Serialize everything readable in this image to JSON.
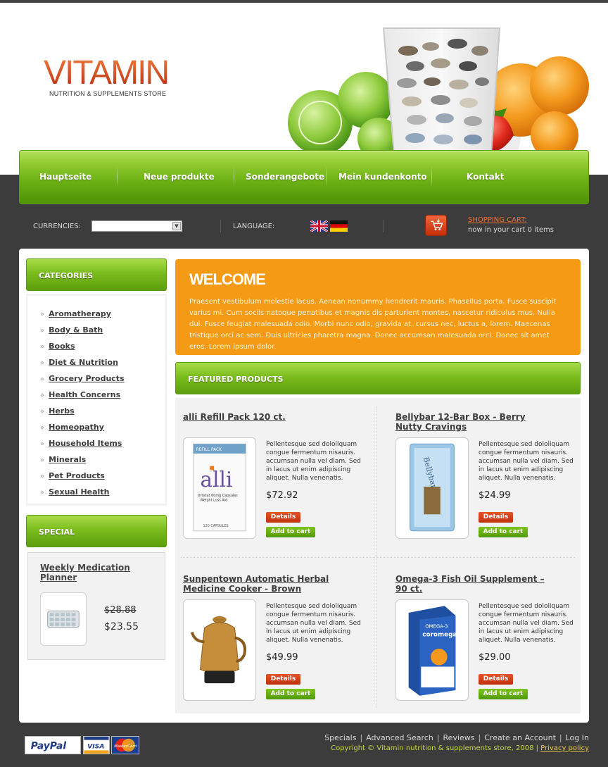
{
  "brand": {
    "title": "VITAMIN",
    "subtitle": "NUTRITION & SUPPLEMENTS STORE"
  },
  "nav": {
    "items": [
      "Hauptseite",
      "Neue produkte",
      "Sonderangebote",
      "Mein kundenkonto",
      "Kontakt"
    ]
  },
  "toolbar": {
    "currencies_label": "CURRENCIES:",
    "currency_value": "",
    "language_label": "LANGUAGE:",
    "languages": [
      "english-flag",
      "german-flag"
    ],
    "cart_link": "SHOPPING CART:",
    "cart_status": "now in your cart 0 items"
  },
  "sidebar": {
    "categories_title": "CATEGORIES",
    "categories": [
      "Aromatherapy",
      "Body & Bath",
      "Books",
      "Diet & Nutrition",
      "Grocery Products",
      "Health Concerns",
      "Herbs",
      "Homeopathy",
      "Household Items",
      "Minerals",
      "Pet Products",
      "Sexual Health"
    ],
    "special_title": "SPECIAL",
    "special": {
      "name": "Weekly Medication Planner",
      "old_price": "$28.88",
      "new_price": "$23.55"
    }
  },
  "welcome": {
    "title": "WELCOME",
    "text": "Praesent vestibulum molestie lacus. Aenean nonummy hendrerit mauris. Phasellus porta. Fusce suscipit varius mi. Cum sociis natoque penatibus et magnis dis parturient montes, nascetur ridiculus mus. Nulla dui. Fusce feugiat malesuada odio. Morbi nunc odio, gravida at, cursus nec, luctus a, lorem. Maecenas tristique orci ac sem. Duis ultricies pharetra magna. Donec accumsan malesuada orci. Donec sit amet eros. Lorem ipsum dolor."
  },
  "featured": {
    "title": "FEATURED PRODUCTS",
    "details_label": "Details",
    "cart_label": "Add to cart",
    "products": [
      {
        "name": "alli Refill Pack 120 ct.",
        "desc": "Pellentesque sed dololiquam congue fermentum nisauris. accumsan nulla vel diam. Sed in lacus ut enim adipiscing aliquet. Nulla venenatis.",
        "price": "$72.92"
      },
      {
        "name": "Bellybar 12-Bar Box - Berry Nutty Cravings",
        "desc": "Pellentesque sed dololiquam congue fermentum nisauris. accumsan nulla vel diam. Sed in lacus ut enim adipiscing aliquet. Nulla venenatis.",
        "price": "$24.99"
      },
      {
        "name": "Sunpentown Automatic Herbal Medicine Cooker - Brown",
        "desc": "Pellentesque sed dololiquam congue fermentum nisauris. accumsan nulla vel diam. Sed in lacus ut enim adipiscing aliquet. Nulla venenatis.",
        "price": "$49.99"
      },
      {
        "name": "Omega-3 Fish Oil Supplement – 90 ct.",
        "desc": "Pellentesque sed dololiquam congue fermentum nisauris. accumsan nulla vel diam. Sed in lacus ut enim adipiscing aliquet. Nulla venenatis.",
        "price": "$29.00"
      }
    ],
    "product_labels": {
      "alli_box_top": "REFILL PACK",
      "alli_logo": "alli",
      "alli_line1": "Orlistat 60mg Capsules",
      "alli_line2": "Weight Loss Aid",
      "alli_count": "120 CAPSULES",
      "bellybar_logo": "Bellybar",
      "omega_top": "OMEGA-3",
      "omega_brand": "coromega"
    }
  },
  "footer": {
    "links": [
      "Specials",
      "Advanced Search",
      "Reviews",
      "Create an Account",
      "Log In"
    ],
    "copyright": "Copyright © Vitamin nutrition & supplements store, 2008 |",
    "privacy": "Privacy policy",
    "payments": {
      "paypal": "PayPal",
      "visa": "VISA",
      "mastercard": "MasterCard"
    }
  },
  "colors": {
    "accent_green": "#7bbd1d",
    "accent_orange": "#f59a14",
    "brand_red": "#d94a1e",
    "background": "#3c3c3c"
  }
}
